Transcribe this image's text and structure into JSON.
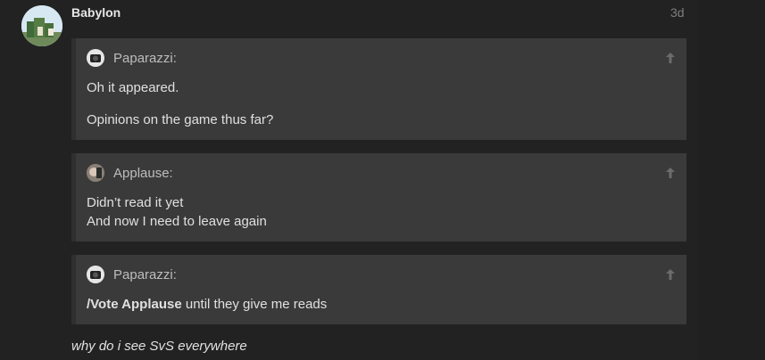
{
  "post": {
    "author": "Babylon",
    "date": "3d",
    "text": "why do i see SvS everywhere"
  },
  "quotes": [
    {
      "author": "Paparazzi:",
      "lines": [
        "Oh it appeared.",
        "Opinions on the game thus far?"
      ]
    },
    {
      "author": "Applause:",
      "lines": [
        "Didn’t read it yet",
        "And now I need to leave again"
      ]
    },
    {
      "author": "Paparazzi:",
      "vote_strong": "/Vote Applause",
      "vote_rest": " until they give me reads"
    }
  ],
  "icons": {
    "jump_to_post": "arrow-up-icon"
  }
}
